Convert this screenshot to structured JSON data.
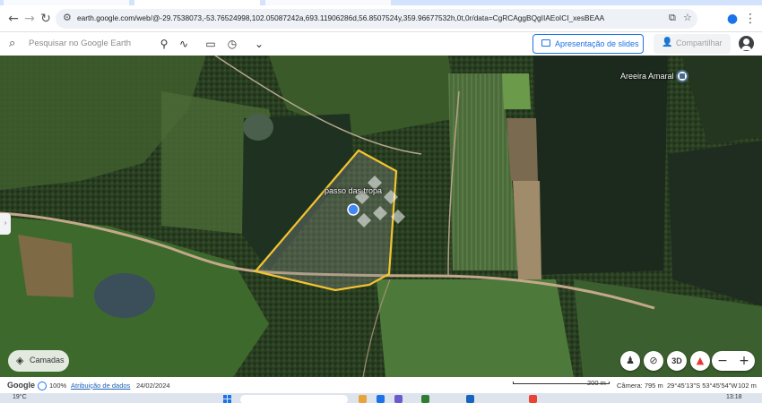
{
  "browser": {
    "url": "earth.google.com/web/@-29.7538073,-53.76524998,102.05087242a,693.11906286d,56.8507524y,359.96677532h,0t,0r/data=CgRCAggBQgIIAEoICI_xesBEAA",
    "nav": {
      "back_icon": "arrow-left-icon",
      "forward_icon": "arrow-right-icon",
      "reload_icon": "reload-icon"
    }
  },
  "toolbar": {
    "search_placeholder": "Pesquisar no Google Earth",
    "slides_label": "Apresentação de slides",
    "share_label": "Compartilhar"
  },
  "map": {
    "polygon_label": "passo das tropa",
    "poi_label": "Areeira Amaral",
    "layers_label": "Camadas",
    "nav_3d_label": "3D",
    "polygon_color": "#f4c430"
  },
  "status": {
    "brand": "Google",
    "load_percent": "100%",
    "attribution": "Atribuição de dados",
    "date": "24/02/2024",
    "scale": "200 m",
    "camera": "Câmera: 795 m",
    "coords": "29°45'13\"S 53°45'54\"W",
    "elevation": "102 m"
  },
  "taskbar": {
    "weather": "19°C",
    "time": "13:18"
  }
}
